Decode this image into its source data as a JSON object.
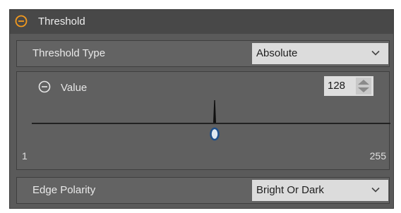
{
  "section": {
    "title": "Threshold",
    "accent_color": "#f39a1e"
  },
  "threshold_type": {
    "label": "Threshold Type",
    "selected": "Absolute"
  },
  "value": {
    "label": "Value",
    "current": "128",
    "min": "1",
    "max": "255",
    "slider_fraction": 0.5
  },
  "edge_polarity": {
    "label": "Edge Polarity",
    "selected": "Bright Or Dark"
  },
  "icons": {
    "section_collapse": "minus-circle-icon",
    "value_collapse": "minus-circle-icon",
    "dropdown": "chevron-down-icon",
    "spinner": "up-down-arrows-icon"
  }
}
